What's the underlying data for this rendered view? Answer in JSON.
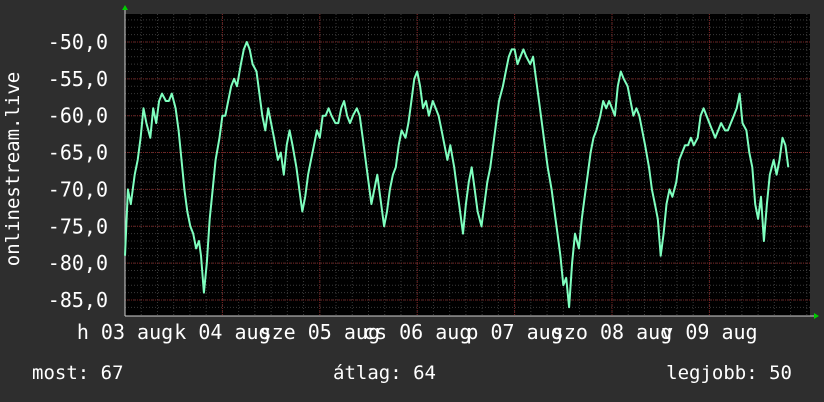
{
  "chart_data": {
    "type": "line",
    "ylabel": "onlinestream.live",
    "ylim": [
      -86.7,
      -45.9
    ],
    "yticks": [
      -50,
      -55,
      -60,
      -65,
      -70,
      -75,
      -80,
      -85
    ],
    "ytick_labels": [
      "-50,0",
      "-55,0",
      "-60,0",
      "-65,0",
      "-70,0",
      "-75,0",
      "-80,0",
      "-85,0"
    ],
    "xlim": [
      0,
      7.55
    ],
    "xticks": [
      {
        "pos": 0,
        "label": "h 03 aug"
      },
      {
        "pos": 1,
        "label": "k 04 aug"
      },
      {
        "pos": 2,
        "label": "sze 05 aug"
      },
      {
        "pos": 3,
        "label": "cs 06 aug"
      },
      {
        "pos": 4,
        "label": "p 07 aug"
      },
      {
        "pos": 5,
        "label": "szo 08 aug"
      },
      {
        "pos": 6,
        "label": "v 09 aug"
      }
    ],
    "grid": true,
    "series_color": "#7fffbf",
    "series": [
      {
        "values": [
          [
            0.0,
            -79
          ],
          [
            0.03,
            -70
          ],
          [
            0.06,
            -72
          ],
          [
            0.1,
            -68
          ],
          [
            0.13,
            -66
          ],
          [
            0.16,
            -63
          ],
          [
            0.19,
            -59
          ],
          [
            0.22,
            -61
          ],
          [
            0.26,
            -63
          ],
          [
            0.29,
            -59
          ],
          [
            0.32,
            -61
          ],
          [
            0.35,
            -58
          ],
          [
            0.38,
            -57
          ],
          [
            0.42,
            -58
          ],
          [
            0.45,
            -58
          ],
          [
            0.48,
            -57
          ],
          [
            0.52,
            -59
          ],
          [
            0.55,
            -62
          ],
          [
            0.58,
            -66
          ],
          [
            0.61,
            -70
          ],
          [
            0.64,
            -73
          ],
          [
            0.67,
            -75
          ],
          [
            0.7,
            -76
          ],
          [
            0.73,
            -78
          ],
          [
            0.76,
            -77
          ],
          [
            0.78,
            -79
          ],
          [
            0.81,
            -84
          ],
          [
            0.84,
            -80
          ],
          [
            0.87,
            -74
          ],
          [
            0.9,
            -70
          ],
          [
            0.93,
            -66
          ],
          [
            0.97,
            -63
          ],
          [
            1.0,
            -60
          ],
          [
            1.03,
            -60
          ],
          [
            1.06,
            -58
          ],
          [
            1.09,
            -56
          ],
          [
            1.12,
            -55
          ],
          [
            1.15,
            -56
          ],
          [
            1.19,
            -53
          ],
          [
            1.22,
            -51
          ],
          [
            1.25,
            -50
          ],
          [
            1.28,
            -51
          ],
          [
            1.31,
            -53
          ],
          [
            1.35,
            -54
          ],
          [
            1.38,
            -57
          ],
          [
            1.41,
            -60
          ],
          [
            1.44,
            -62
          ],
          [
            1.47,
            -59
          ],
          [
            1.5,
            -61
          ],
          [
            1.53,
            -63
          ],
          [
            1.57,
            -66
          ],
          [
            1.6,
            -65
          ],
          [
            1.63,
            -68
          ],
          [
            1.66,
            -64
          ],
          [
            1.69,
            -62
          ],
          [
            1.72,
            -64
          ],
          [
            1.76,
            -67
          ],
          [
            1.79,
            -70
          ],
          [
            1.82,
            -73
          ],
          [
            1.85,
            -71
          ],
          [
            1.88,
            -68
          ],
          [
            1.91,
            -66
          ],
          [
            1.94,
            -64
          ],
          [
            1.97,
            -62
          ],
          [
            2.0,
            -63
          ],
          [
            2.03,
            -60
          ],
          [
            2.06,
            -60
          ],
          [
            2.09,
            -59
          ],
          [
            2.12,
            -60
          ],
          [
            2.16,
            -61
          ],
          [
            2.19,
            -61
          ],
          [
            2.22,
            -59
          ],
          [
            2.25,
            -58
          ],
          [
            2.28,
            -60
          ],
          [
            2.31,
            -61
          ],
          [
            2.34,
            -60
          ],
          [
            2.38,
            -59
          ],
          [
            2.41,
            -60
          ],
          [
            2.44,
            -63
          ],
          [
            2.47,
            -66
          ],
          [
            2.5,
            -69
          ],
          [
            2.53,
            -72
          ],
          [
            2.56,
            -70
          ],
          [
            2.59,
            -68
          ],
          [
            2.62,
            -71
          ],
          [
            2.66,
            -75
          ],
          [
            2.69,
            -73
          ],
          [
            2.72,
            -70
          ],
          [
            2.75,
            -68
          ],
          [
            2.78,
            -67
          ],
          [
            2.81,
            -64
          ],
          [
            2.84,
            -62
          ],
          [
            2.88,
            -63
          ],
          [
            2.91,
            -61
          ],
          [
            2.94,
            -58
          ],
          [
            2.97,
            -55
          ],
          [
            3.0,
            -54
          ],
          [
            3.03,
            -56
          ],
          [
            3.06,
            -59
          ],
          [
            3.09,
            -58
          ],
          [
            3.12,
            -60
          ],
          [
            3.16,
            -58
          ],
          [
            3.19,
            -59
          ],
          [
            3.22,
            -60
          ],
          [
            3.25,
            -62
          ],
          [
            3.28,
            -64
          ],
          [
            3.31,
            -66
          ],
          [
            3.34,
            -64
          ],
          [
            3.38,
            -67
          ],
          [
            3.41,
            -70
          ],
          [
            3.44,
            -73
          ],
          [
            3.47,
            -76
          ],
          [
            3.5,
            -72
          ],
          [
            3.53,
            -69
          ],
          [
            3.56,
            -67
          ],
          [
            3.59,
            -70
          ],
          [
            3.62,
            -73
          ],
          [
            3.66,
            -75
          ],
          [
            3.69,
            -72
          ],
          [
            3.72,
            -69
          ],
          [
            3.75,
            -67
          ],
          [
            3.78,
            -64
          ],
          [
            3.81,
            -61
          ],
          [
            3.84,
            -58
          ],
          [
            3.88,
            -56
          ],
          [
            3.91,
            -54
          ],
          [
            3.94,
            -52
          ],
          [
            3.97,
            -51
          ],
          [
            4.0,
            -51
          ],
          [
            4.03,
            -53
          ],
          [
            4.06,
            -52
          ],
          [
            4.09,
            -51
          ],
          [
            4.12,
            -52
          ],
          [
            4.16,
            -53
          ],
          [
            4.19,
            -52
          ],
          [
            4.22,
            -55
          ],
          [
            4.25,
            -58
          ],
          [
            4.28,
            -61
          ],
          [
            4.31,
            -64
          ],
          [
            4.34,
            -67
          ],
          [
            4.38,
            -70
          ],
          [
            4.41,
            -73
          ],
          [
            4.44,
            -76
          ],
          [
            4.47,
            -79
          ],
          [
            4.5,
            -83
          ],
          [
            4.53,
            -82
          ],
          [
            4.56,
            -86
          ],
          [
            4.59,
            -80
          ],
          [
            4.62,
            -76
          ],
          [
            4.66,
            -78
          ],
          [
            4.69,
            -74
          ],
          [
            4.72,
            -71
          ],
          [
            4.75,
            -68
          ],
          [
            4.78,
            -65
          ],
          [
            4.81,
            -63
          ],
          [
            4.84,
            -62
          ],
          [
            4.88,
            -60
          ],
          [
            4.91,
            -58
          ],
          [
            4.94,
            -59
          ],
          [
            4.97,
            -58
          ],
          [
            5.0,
            -59
          ],
          [
            5.03,
            -60
          ],
          [
            5.06,
            -56
          ],
          [
            5.09,
            -54
          ],
          [
            5.12,
            -55
          ],
          [
            5.16,
            -56
          ],
          [
            5.19,
            -58
          ],
          [
            5.22,
            -60
          ],
          [
            5.25,
            -59
          ],
          [
            5.28,
            -60
          ],
          [
            5.31,
            -62
          ],
          [
            5.34,
            -64
          ],
          [
            5.38,
            -67
          ],
          [
            5.41,
            -70
          ],
          [
            5.44,
            -72
          ],
          [
            5.47,
            -74
          ],
          [
            5.5,
            -79
          ],
          [
            5.53,
            -76
          ],
          [
            5.56,
            -72
          ],
          [
            5.59,
            -70
          ],
          [
            5.62,
            -71
          ],
          [
            5.66,
            -69
          ],
          [
            5.69,
            -66
          ],
          [
            5.72,
            -65
          ],
          [
            5.75,
            -64
          ],
          [
            5.78,
            -64
          ],
          [
            5.81,
            -63
          ],
          [
            5.84,
            -64
          ],
          [
            5.88,
            -63
          ],
          [
            5.91,
            -60
          ],
          [
            5.94,
            -59
          ],
          [
            5.97,
            -60
          ],
          [
            6.0,
            -61
          ],
          [
            6.03,
            -62
          ],
          [
            6.06,
            -63
          ],
          [
            6.09,
            -62
          ],
          [
            6.12,
            -61
          ],
          [
            6.16,
            -62
          ],
          [
            6.19,
            -62
          ],
          [
            6.22,
            -61
          ],
          [
            6.25,
            -60
          ],
          [
            6.28,
            -59
          ],
          [
            6.31,
            -57
          ],
          [
            6.34,
            -61
          ],
          [
            6.38,
            -62
          ],
          [
            6.41,
            -65
          ],
          [
            6.44,
            -67
          ],
          [
            6.47,
            -72
          ],
          [
            6.5,
            -74
          ],
          [
            6.53,
            -71
          ],
          [
            6.56,
            -77
          ],
          [
            6.59,
            -72
          ],
          [
            6.62,
            -68
          ],
          [
            6.66,
            -66
          ],
          [
            6.69,
            -68
          ],
          [
            6.72,
            -66
          ],
          [
            6.75,
            -63
          ],
          [
            6.78,
            -64
          ],
          [
            6.81,
            -67
          ]
        ]
      }
    ]
  },
  "stats": {
    "now": "most: 67",
    "avg": "átlag: 64",
    "best": "legjobb: 50"
  }
}
